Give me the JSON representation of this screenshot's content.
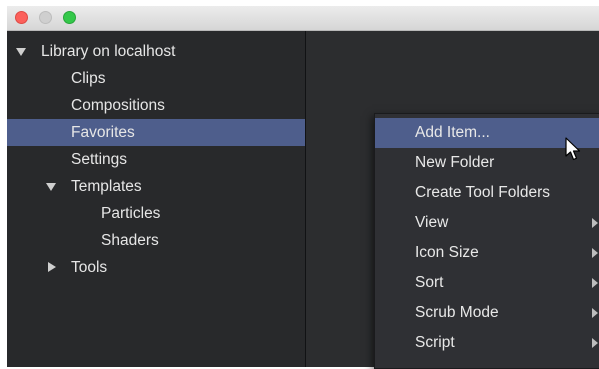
{
  "window": {
    "traffic_lights": [
      "close",
      "minimize",
      "zoom"
    ]
  },
  "tree": {
    "root": {
      "label": "Library on localhost",
      "expanded": true
    },
    "items": [
      {
        "label": "Clips"
      },
      {
        "label": "Compositions"
      },
      {
        "label": "Favorites",
        "selected": true
      },
      {
        "label": "Settings"
      },
      {
        "label": "Templates",
        "expanded": true,
        "children": [
          {
            "label": "Particles"
          },
          {
            "label": "Shaders"
          }
        ]
      },
      {
        "label": "Tools",
        "expanded": false
      }
    ]
  },
  "context_menu": {
    "items": [
      {
        "label": "Add Item...",
        "highlighted": true,
        "submenu": false
      },
      {
        "label": "New Folder",
        "submenu": false
      },
      {
        "label": "Create Tool Folders",
        "submenu": false
      },
      {
        "label": "View",
        "submenu": true
      },
      {
        "label": "Icon Size",
        "submenu": true
      },
      {
        "label": "Sort",
        "submenu": true
      },
      {
        "label": "Scrub Mode",
        "submenu": true
      },
      {
        "label": "Script",
        "submenu": true
      }
    ]
  },
  "colors": {
    "selection": "#4e5e8c",
    "panel_bg": "#28292b",
    "menu_bg": "#2f3034",
    "text": "#e6e6e6"
  },
  "icons": {
    "cursor": "mouse-pointer-icon"
  }
}
